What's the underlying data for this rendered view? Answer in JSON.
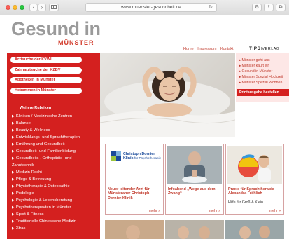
{
  "browser": {
    "url": "www.muenster-gesundheit.de",
    "back_label": "‹",
    "forward_label": "›",
    "reload_label": "↻",
    "settings_label": "⚙",
    "share_label": "⇪",
    "tabs_label": "⧉"
  },
  "site": {
    "logo_main": "Gesund in",
    "logo_sub": "MÜNSTER",
    "tips_logo": "TIPS",
    "tips_logo_sub": "|VERLAG",
    "topnav": [
      "Home",
      "Impressum",
      "Kontakt"
    ]
  },
  "sidebar": {
    "pills": [
      "Arztsuche der KVWL",
      "Zahnarztsuche der KZBV",
      "Apotheken in Münster",
      "Hebammen in Münster"
    ],
    "section_title": "Weitere Rubriken",
    "categories": [
      "Kliniken / Medizinische Zentren",
      "Balance",
      "Beauty & Wellness",
      "Entwicklungs- und Sprachtherapien",
      "Ernährung und Gesundheit",
      "Gesundheit- und Familienbildung",
      "Gesundheits-, Orthopädie- und",
      "Zahntechnik",
      "Medizin-Recht",
      "Pflege & Betreuung",
      "Physiotherapie & Osteopathie",
      "Podologie",
      "Psychologie & Lebensberatung",
      "Psychotherapeuten in Münster",
      "Sport & Fitness",
      "Traditionelle Chinesische Medizin",
      "Xtras"
    ]
  },
  "rightcol": {
    "links": [
      "Münster geht aus",
      "Münster kauft ein",
      "Gesund in Münster",
      "Münster Spezial Hochzeit",
      "Münster Spezial Wohnen"
    ],
    "order_button": "Printausgabe bestellen"
  },
  "cards": [
    {
      "logo_line1": "Christoph Dornier",
      "logo_line2": "Klinik",
      "logo_line3": "für Psychotherapie",
      "title": "Neuer leitender Arzt für Münsteraner Christoph-Dornier-Klinik",
      "sub": "",
      "more": "mehr »"
    },
    {
      "title": "Infoabend „Wege aus dem Zwang“",
      "sub": "",
      "more": "mehr »"
    },
    {
      "title": "Praxis für Sprachtherapie Alexandra Fröhlich",
      "sub": "Hilfe für Groß & Klein",
      "more": "mehr »"
    }
  ],
  "colors": {
    "brand_red": "#d4201f",
    "logo_gray": "#9a9a9a",
    "right_bg": "#fde7e6"
  }
}
